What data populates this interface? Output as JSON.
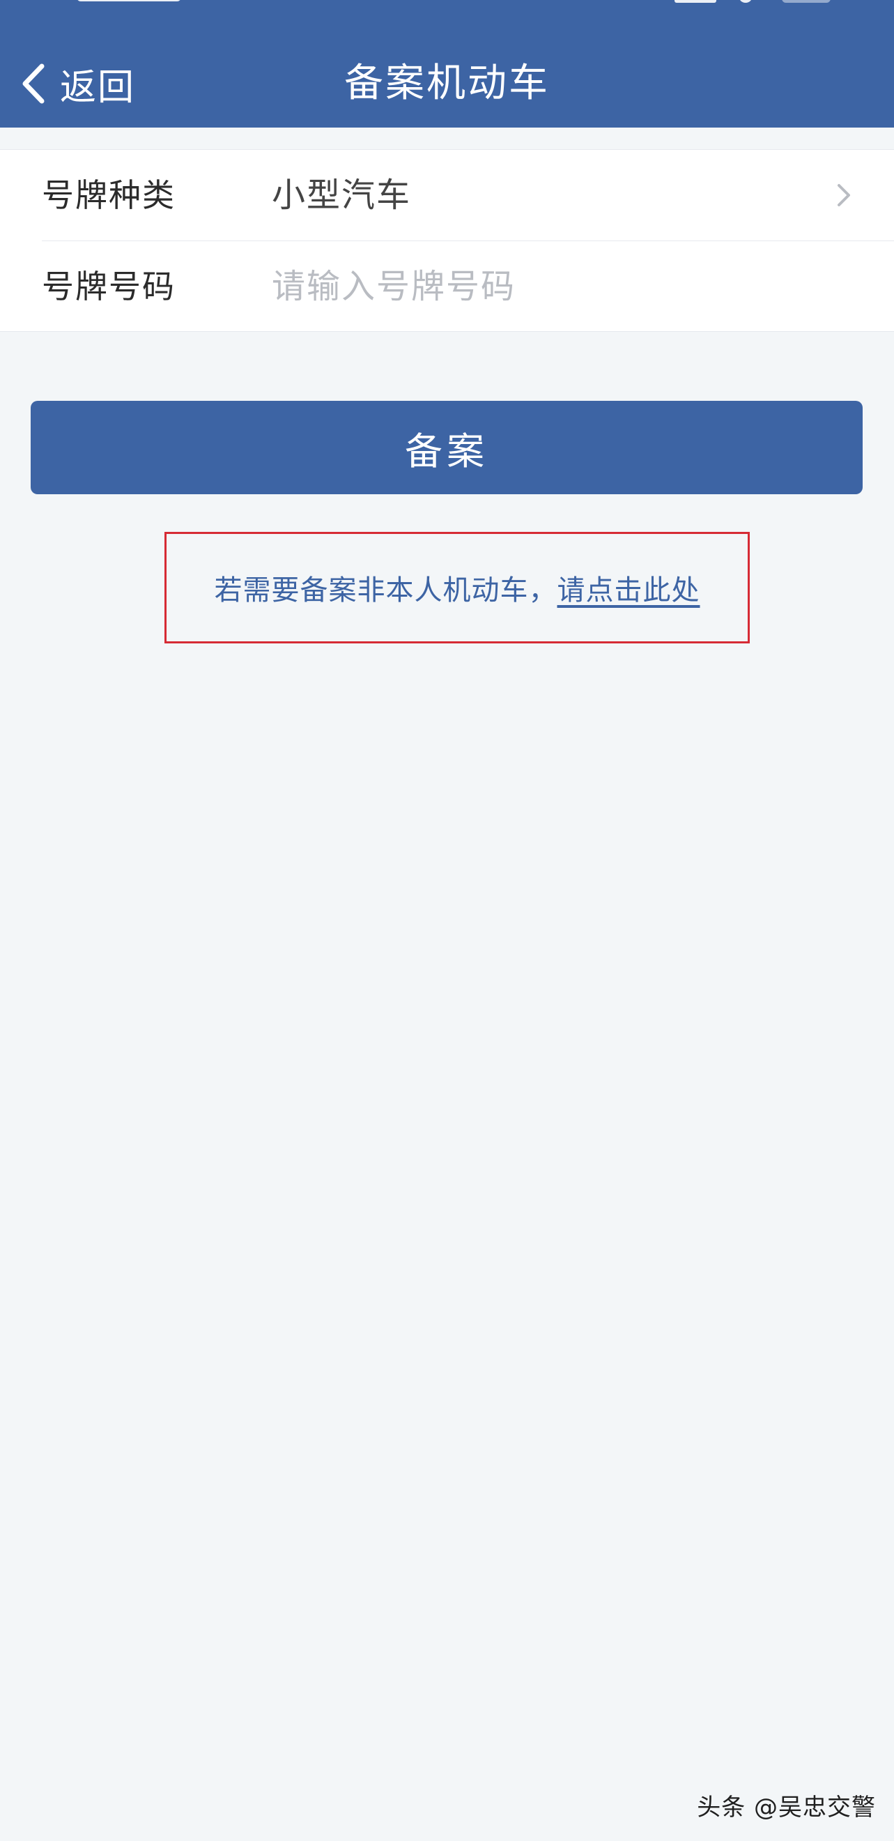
{
  "header": {
    "back_label": "返回",
    "title": "备案机动车",
    "background_color": "#3d64a4"
  },
  "form": {
    "plate_type": {
      "label": "号牌种类",
      "value": "小型汽车"
    },
    "plate_number": {
      "label": "号牌号码",
      "placeholder": "请输入号牌号码",
      "value": ""
    }
  },
  "submit": {
    "label": "备案"
  },
  "notice": {
    "text": "若需要备案非本人机动车，",
    "link": "请点击此处",
    "highlight_color": "#d62b35"
  },
  "watermark": {
    "text": "头条 @吴忠交警"
  },
  "icons": {
    "back": "chevron-left-icon",
    "row_arrow": "chevron-right-icon"
  }
}
